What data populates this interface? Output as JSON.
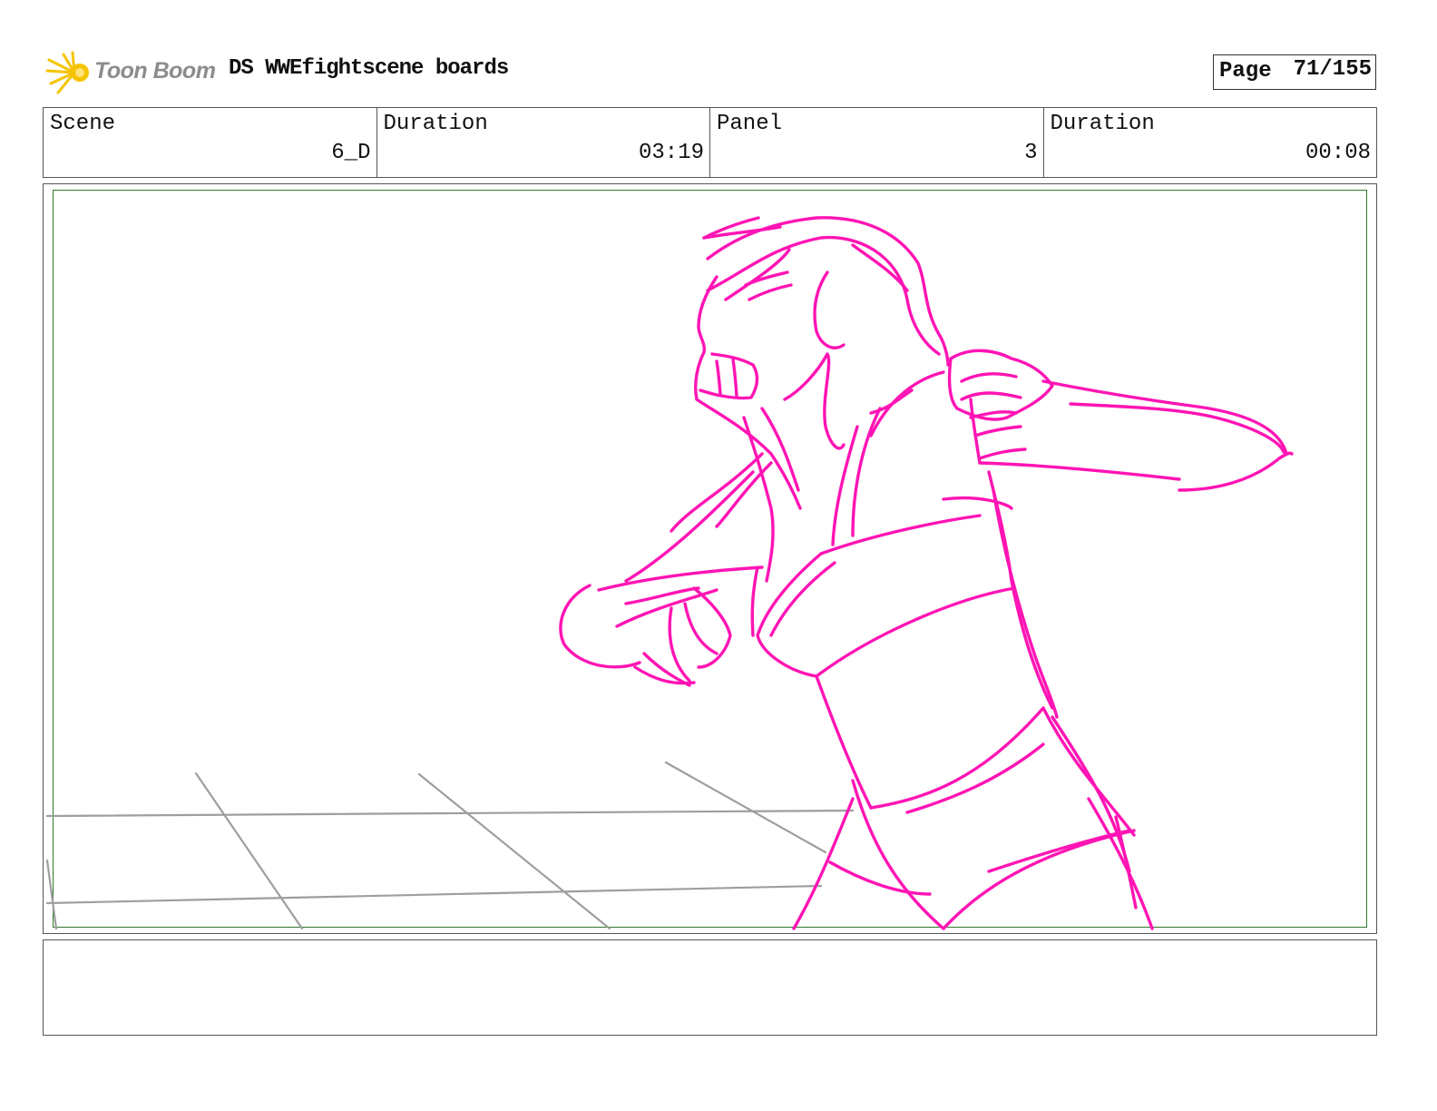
{
  "header": {
    "logo_text": "Toon Boom",
    "title": "DS WWEfightscene boards",
    "page_label": "Page",
    "page_value": "71/155"
  },
  "info": {
    "scene_label": "Scene",
    "scene_value": "6_D",
    "scene_duration_label": "Duration",
    "scene_duration_value": "03:19",
    "panel_label": "Panel",
    "panel_value": "3",
    "panel_duration_label": "Duration",
    "panel_duration_value": "00:08"
  },
  "notes": {
    "text": ""
  },
  "colors": {
    "sketch": "#ff14b4",
    "guides": "#9e9e9e",
    "safe_frame": "#2f7a2f",
    "logo": "#f5c400"
  },
  "icons": [
    "toon-boom-logo-icon"
  ]
}
